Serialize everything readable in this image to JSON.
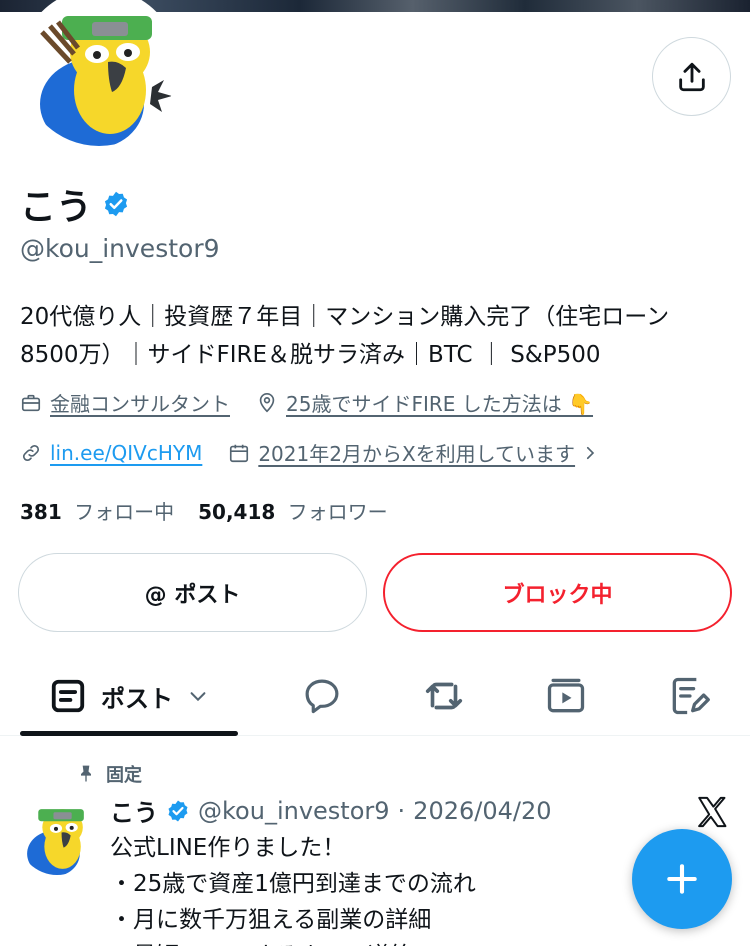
{
  "profile": {
    "name": "こう",
    "handle": "@kou_investor9",
    "bio_lines": [
      "20代億り人｜投資歴７年目｜マンション購入完了（住宅ローン",
      "8500万）｜サイドFIRE＆脱サラ済み｜BTC ｜ S&P500"
    ],
    "category": "金融コンサルタント",
    "location": "25歳でサイドFIRE した方法は 👇",
    "website": "lin.ee/QIVcHYM",
    "joined": "2021年2月からXを利用しています",
    "following_count": "381",
    "following_label": "フォロー中",
    "followers_count": "50,418",
    "followers_label": "フォロワー"
  },
  "buttons": {
    "mention": "@ ポスト",
    "blocked": "ブロック中"
  },
  "tabs": {
    "active_label": "ポスト"
  },
  "pinned_tweet": {
    "pinned_label": "固定",
    "name": "こう",
    "handle": "@kou_investor9",
    "separator": "·",
    "date": "2026/04/20",
    "text": "公式LINE作りました！\n・25歳で資産1億円到達までの流れ\n・月に数千万狙える副業の詳細\n・最短でFIREするまでの道筋"
  },
  "colors": {
    "accent": "#1d9bf0",
    "danger": "#f4212e",
    "text": "#0f1419",
    "muted": "#536471"
  }
}
